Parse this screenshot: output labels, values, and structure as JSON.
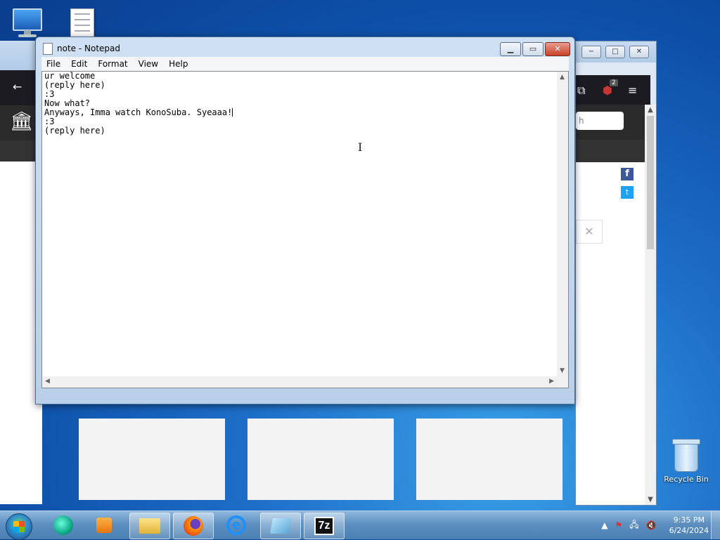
{
  "desktop": {
    "recycle_bin_label": "Recycle Bin"
  },
  "browser": {
    "minimize": "−",
    "restore": "□",
    "close": "✕",
    "back_icon": "←",
    "extension_icon": "⧉",
    "ublock_badge": "2",
    "menu_icon": "≡",
    "search_placeholder": "h",
    "facebook": "f",
    "twitter": "t",
    "dismiss": "✕"
  },
  "notepad": {
    "title": "note - Notepad",
    "menu": [
      "File",
      "Edit",
      "Format",
      "View",
      "Help"
    ],
    "lines": [
      "ur welcome",
      "(reply here)",
      ":3",
      "Now what?",
      "Anyways, Imma watch KonoSuba. Syeaaa!",
      "",
      ":3",
      "(reply here)"
    ]
  },
  "taskbar": {
    "items": [
      "ccleaner",
      "media-player",
      "file-explorer",
      "firefox",
      "internet-explorer",
      "notepad",
      "7-zip"
    ],
    "sevenzip_label": "7z",
    "clock_time": "9:35 PM",
    "clock_date": "6/24/2024"
  }
}
